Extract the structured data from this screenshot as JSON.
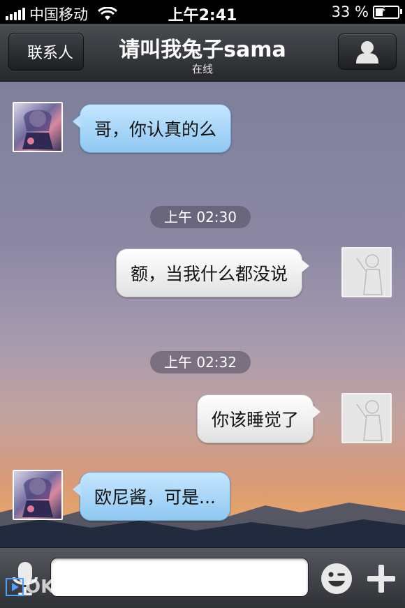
{
  "status_bar": {
    "carrier": "中国移动",
    "time": "上午2:41",
    "battery": "33 %",
    "battery_level": 0.33,
    "icons": [
      "signal-icon",
      "wifi-icon",
      "battery-icon"
    ]
  },
  "nav": {
    "back_label": "联系人",
    "title": "请叫我兔子sama",
    "subtitle": "在线",
    "profile_icon": "person-icon"
  },
  "messages": [
    {
      "side": "in",
      "text": "哥，你认真的么"
    },
    {
      "timestamp": "上午 02:30"
    },
    {
      "side": "out",
      "text": "额，当我什么都没说"
    },
    {
      "timestamp": "上午 02:32"
    },
    {
      "side": "out",
      "text": "你该睡觉了"
    },
    {
      "side": "in",
      "text": "欧尼酱，可是..."
    }
  ],
  "input_bar": {
    "text_value": "",
    "icons": [
      "microphone-icon",
      "emoji-icon",
      "plus-icon"
    ]
  },
  "watermark": "OKO.CO",
  "colors": {
    "incoming_bubble": "#9fd1f7",
    "outgoing_bubble": "#f0f0f0",
    "nav_bar": "#35383c"
  }
}
